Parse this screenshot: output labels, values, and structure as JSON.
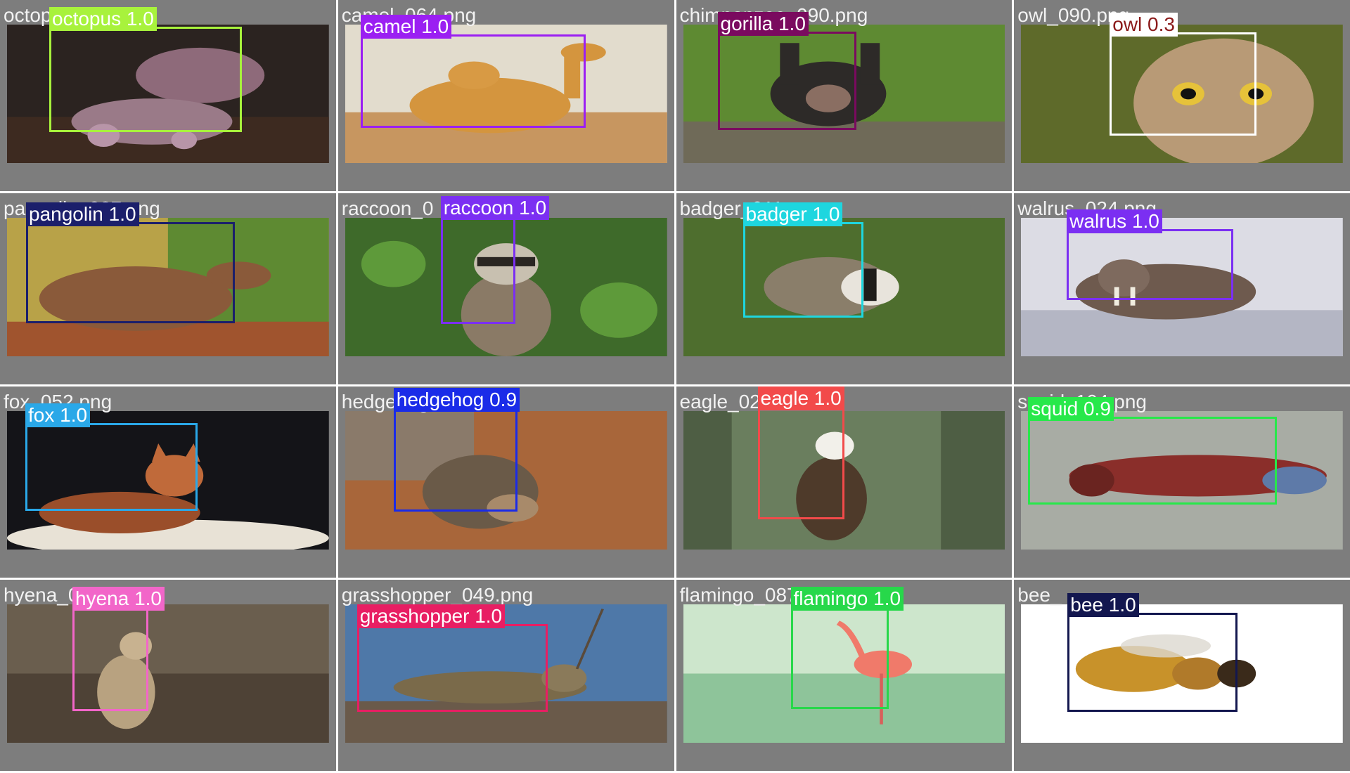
{
  "detections": [
    {
      "file": "octopus_",
      "class": "octopus",
      "score": "1.0",
      "box_color": "#a8f23c",
      "label_text_color": "#ffffff"
    },
    {
      "file": "camel_064.png",
      "class": "camel",
      "score": "1.0",
      "box_color": "#9b1ff2",
      "label_text_color": "#ffffff"
    },
    {
      "file": "chimpanzee_090.png",
      "class": "gorilla",
      "score": "1.0",
      "box_color": "#7a0a5f",
      "label_text_color": "#ffffff"
    },
    {
      "file": "owl_090.png",
      "class": "owl",
      "score": "0.3",
      "box_color": "#ffffff",
      "label_text_color": "#8b1a1a"
    },
    {
      "file": "pangolin_027.png",
      "class": "pangolin",
      "score": "1.0",
      "box_color": "#1b1f6b",
      "label_text_color": "#ffffff"
    },
    {
      "file": "raccoon_0",
      "class": "raccoon",
      "score": "1.0",
      "box_color": "#7b2ff2",
      "label_text_color": "#ffffff"
    },
    {
      "file": "badger_011.png",
      "class": "badger",
      "score": "1.0",
      "box_color": "#1ed6df",
      "label_text_color": "#ffffff"
    },
    {
      "file": "walrus_024.png",
      "class": "walrus",
      "score": "1.0",
      "box_color": "#7b2ff2",
      "label_text_color": "#ffffff"
    },
    {
      "file": "fox_052.png",
      "class": "fox",
      "score": "1.0",
      "box_color": "#2aa8e8",
      "label_text_color": "#ffffff"
    },
    {
      "file": "hedgehog",
      "class": "hedgehog",
      "score": "0.9",
      "box_color": "#1a2be8",
      "label_text_color": "#ffffff"
    },
    {
      "file": "eagle_025",
      "class": "eagle",
      "score": "1.0",
      "box_color": "#f24a4a",
      "label_text_color": "#ffffff"
    },
    {
      "file": "squid_104.png",
      "class": "squid",
      "score": "0.9",
      "box_color": "#27e84a",
      "label_text_color": "#ffffff"
    },
    {
      "file": "hyena_005",
      "class": "hyena",
      "score": "1.0",
      "box_color": "#f266c9",
      "label_text_color": "#ffffff"
    },
    {
      "file": "grasshopper_049.png",
      "class": "grasshopper",
      "score": "1.0",
      "box_color": "#e81e63",
      "label_text_color": "#ffffff"
    },
    {
      "file": "flamingo_087.png",
      "class": "flamingo",
      "score": "1.0",
      "box_color": "#27d84a",
      "label_text_color": "#ffffff"
    },
    {
      "file": "bee_",
      "class": "bee",
      "score": "1.0",
      "box_color": "#13174f",
      "label_text_color": "#ffffff"
    }
  ]
}
